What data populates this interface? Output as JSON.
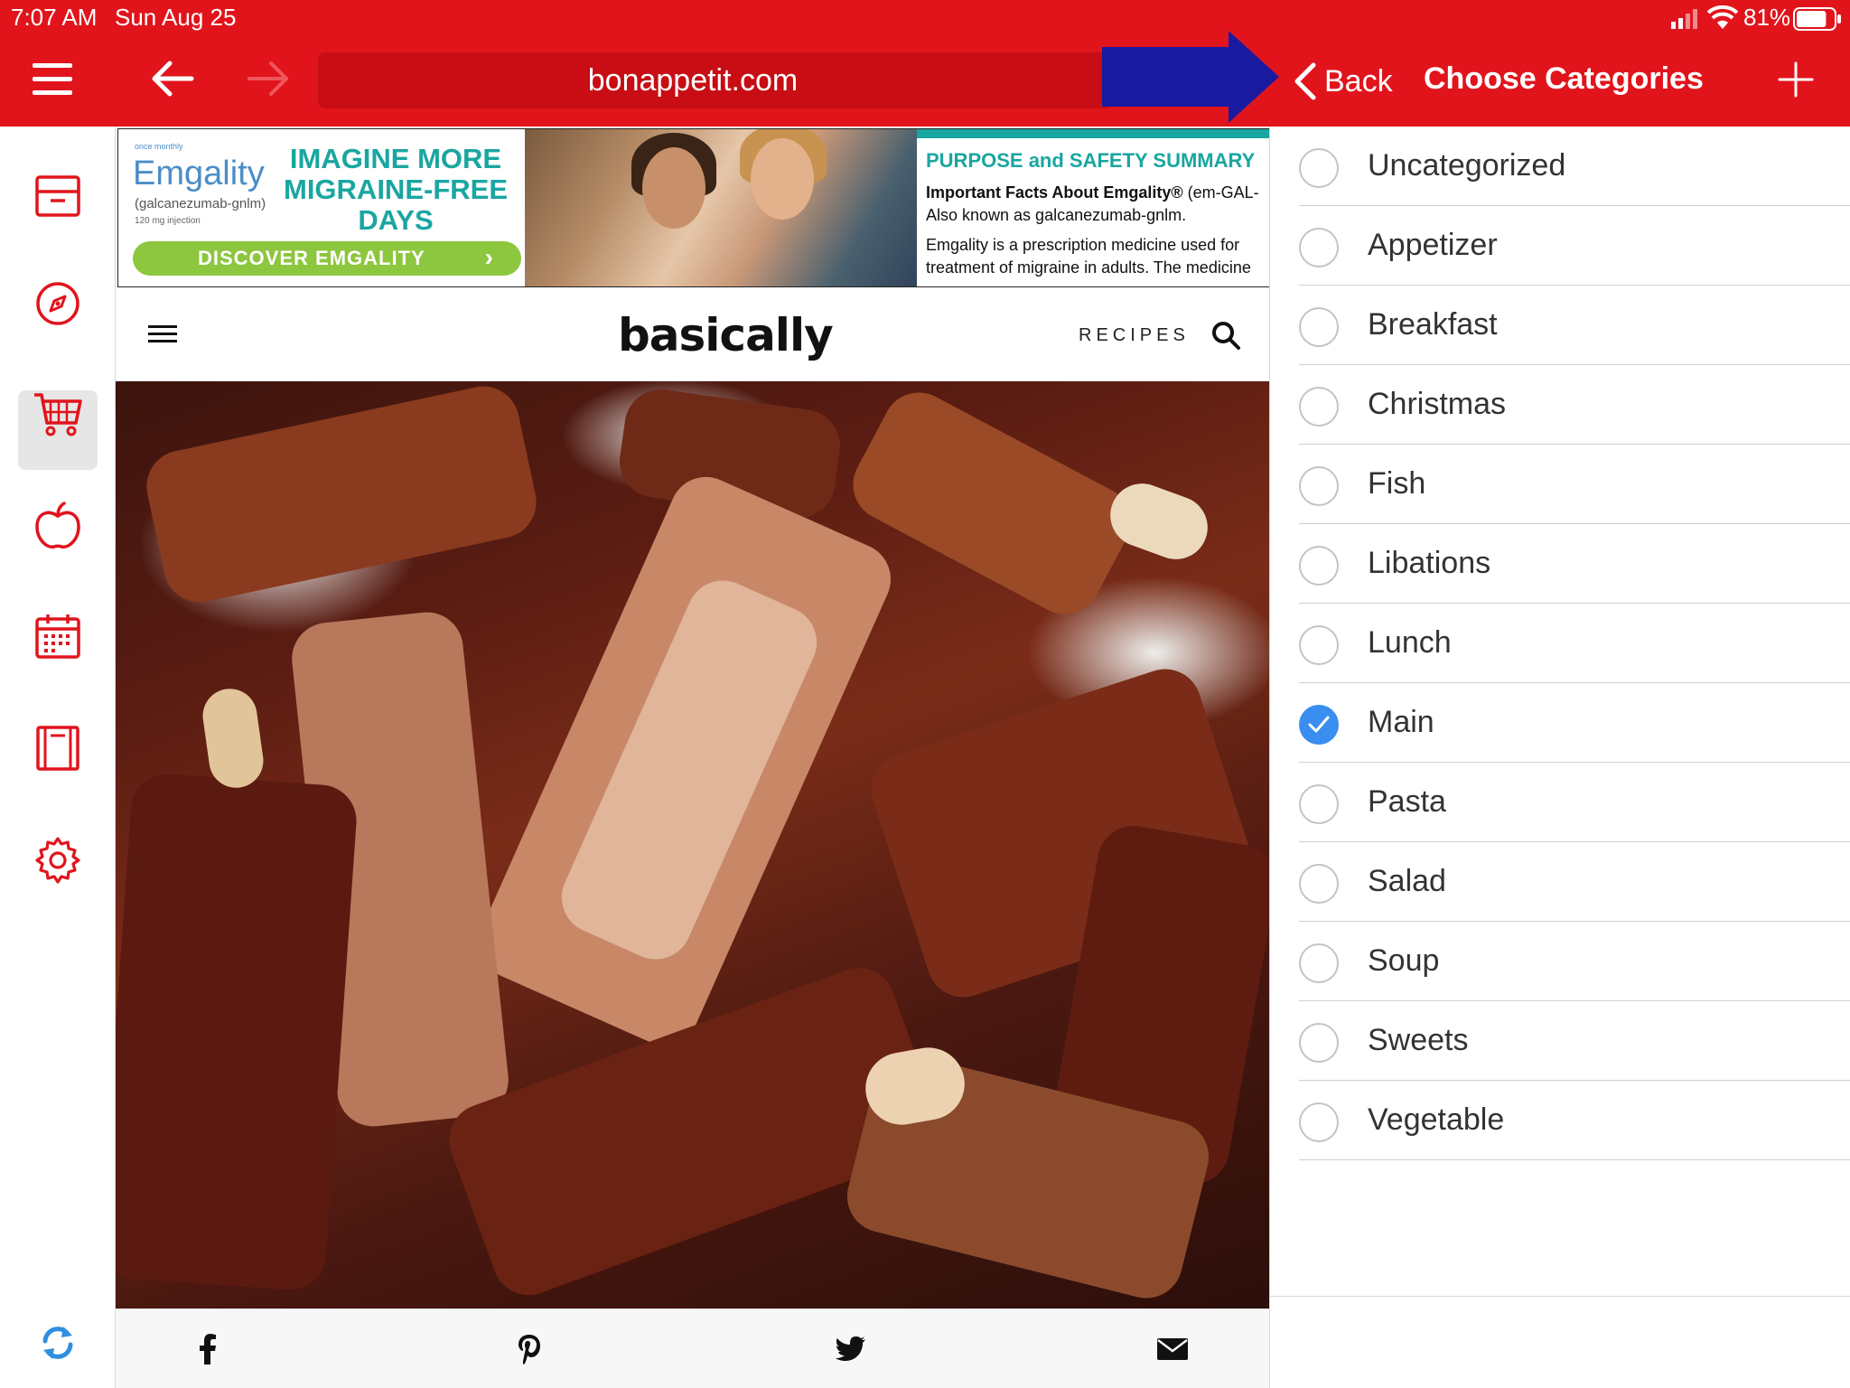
{
  "status_bar": {
    "time": "7:07 AM",
    "date": "Sun Aug 25",
    "battery_percent": "81%",
    "battery_level": 0.81
  },
  "browser": {
    "url": "bonappetit.com",
    "back_icon": "arrow-left-icon",
    "forward_icon": "arrow-right-icon",
    "menu_icon": "hamburger-icon"
  },
  "colors": {
    "brand_red": "#e1141c",
    "url_field": "#c80d14",
    "annotation_arrow": "#1a1aa0",
    "check_blue": "#3a8ef0"
  },
  "category_panel": {
    "back_label": "Back",
    "title": "Choose Categories",
    "add_icon": "plus-icon",
    "categories": [
      {
        "label": "Uncategorized",
        "checked": false
      },
      {
        "label": "Appetizer",
        "checked": false
      },
      {
        "label": "Breakfast",
        "checked": false
      },
      {
        "label": "Christmas",
        "checked": false
      },
      {
        "label": "Fish",
        "checked": false
      },
      {
        "label": "Libations",
        "checked": false
      },
      {
        "label": "Lunch",
        "checked": false
      },
      {
        "label": "Main",
        "checked": true
      },
      {
        "label": "Pasta",
        "checked": false
      },
      {
        "label": "Salad",
        "checked": false
      },
      {
        "label": "Soup",
        "checked": false
      },
      {
        "label": "Sweets",
        "checked": false
      },
      {
        "label": "Vegetable",
        "checked": false
      }
    ]
  },
  "sidebar": {
    "items": [
      {
        "icon": "inbox-tray-icon",
        "active": false
      },
      {
        "icon": "compass-icon",
        "active": true
      },
      {
        "icon": "shopping-cart-icon",
        "active": false
      },
      {
        "icon": "apple-icon",
        "active": false
      },
      {
        "icon": "calendar-icon",
        "active": false
      },
      {
        "icon": "book-icon",
        "active": false
      },
      {
        "icon": "gear-icon",
        "active": false
      }
    ],
    "sync_icon": "sync-icon"
  },
  "ad": {
    "brand_small": "once monthly",
    "brand": "Emgality",
    "generic_name": "(galcanezumab-gnlm)",
    "dose": "120 mg injection",
    "headline_lines": [
      "IMAGINE MORE",
      "MIGRAINE-FREE",
      "DAYS"
    ],
    "cta": "DISCOVER EMGALITY",
    "right_title": "PURPOSE and SAFETY SUMMARY",
    "right_line1_bold": "Important Facts About Emgality®",
    "right_line1_rest": " (em-GAL-",
    "right_line2": "Also known as galcanezumab-gnlm.",
    "right_line3": "Emgality is a prescription medicine used for",
    "right_line4": "treatment of migraine in adults. The medicine"
  },
  "site": {
    "logo": "basically",
    "nav_recipes": "RECIPES",
    "search_icon": "search-icon",
    "menu_icon": "hamburger-icon"
  },
  "share_bar": {
    "icons": [
      "facebook-icon",
      "pinterest-icon",
      "twitter-icon",
      "mail-icon"
    ]
  }
}
